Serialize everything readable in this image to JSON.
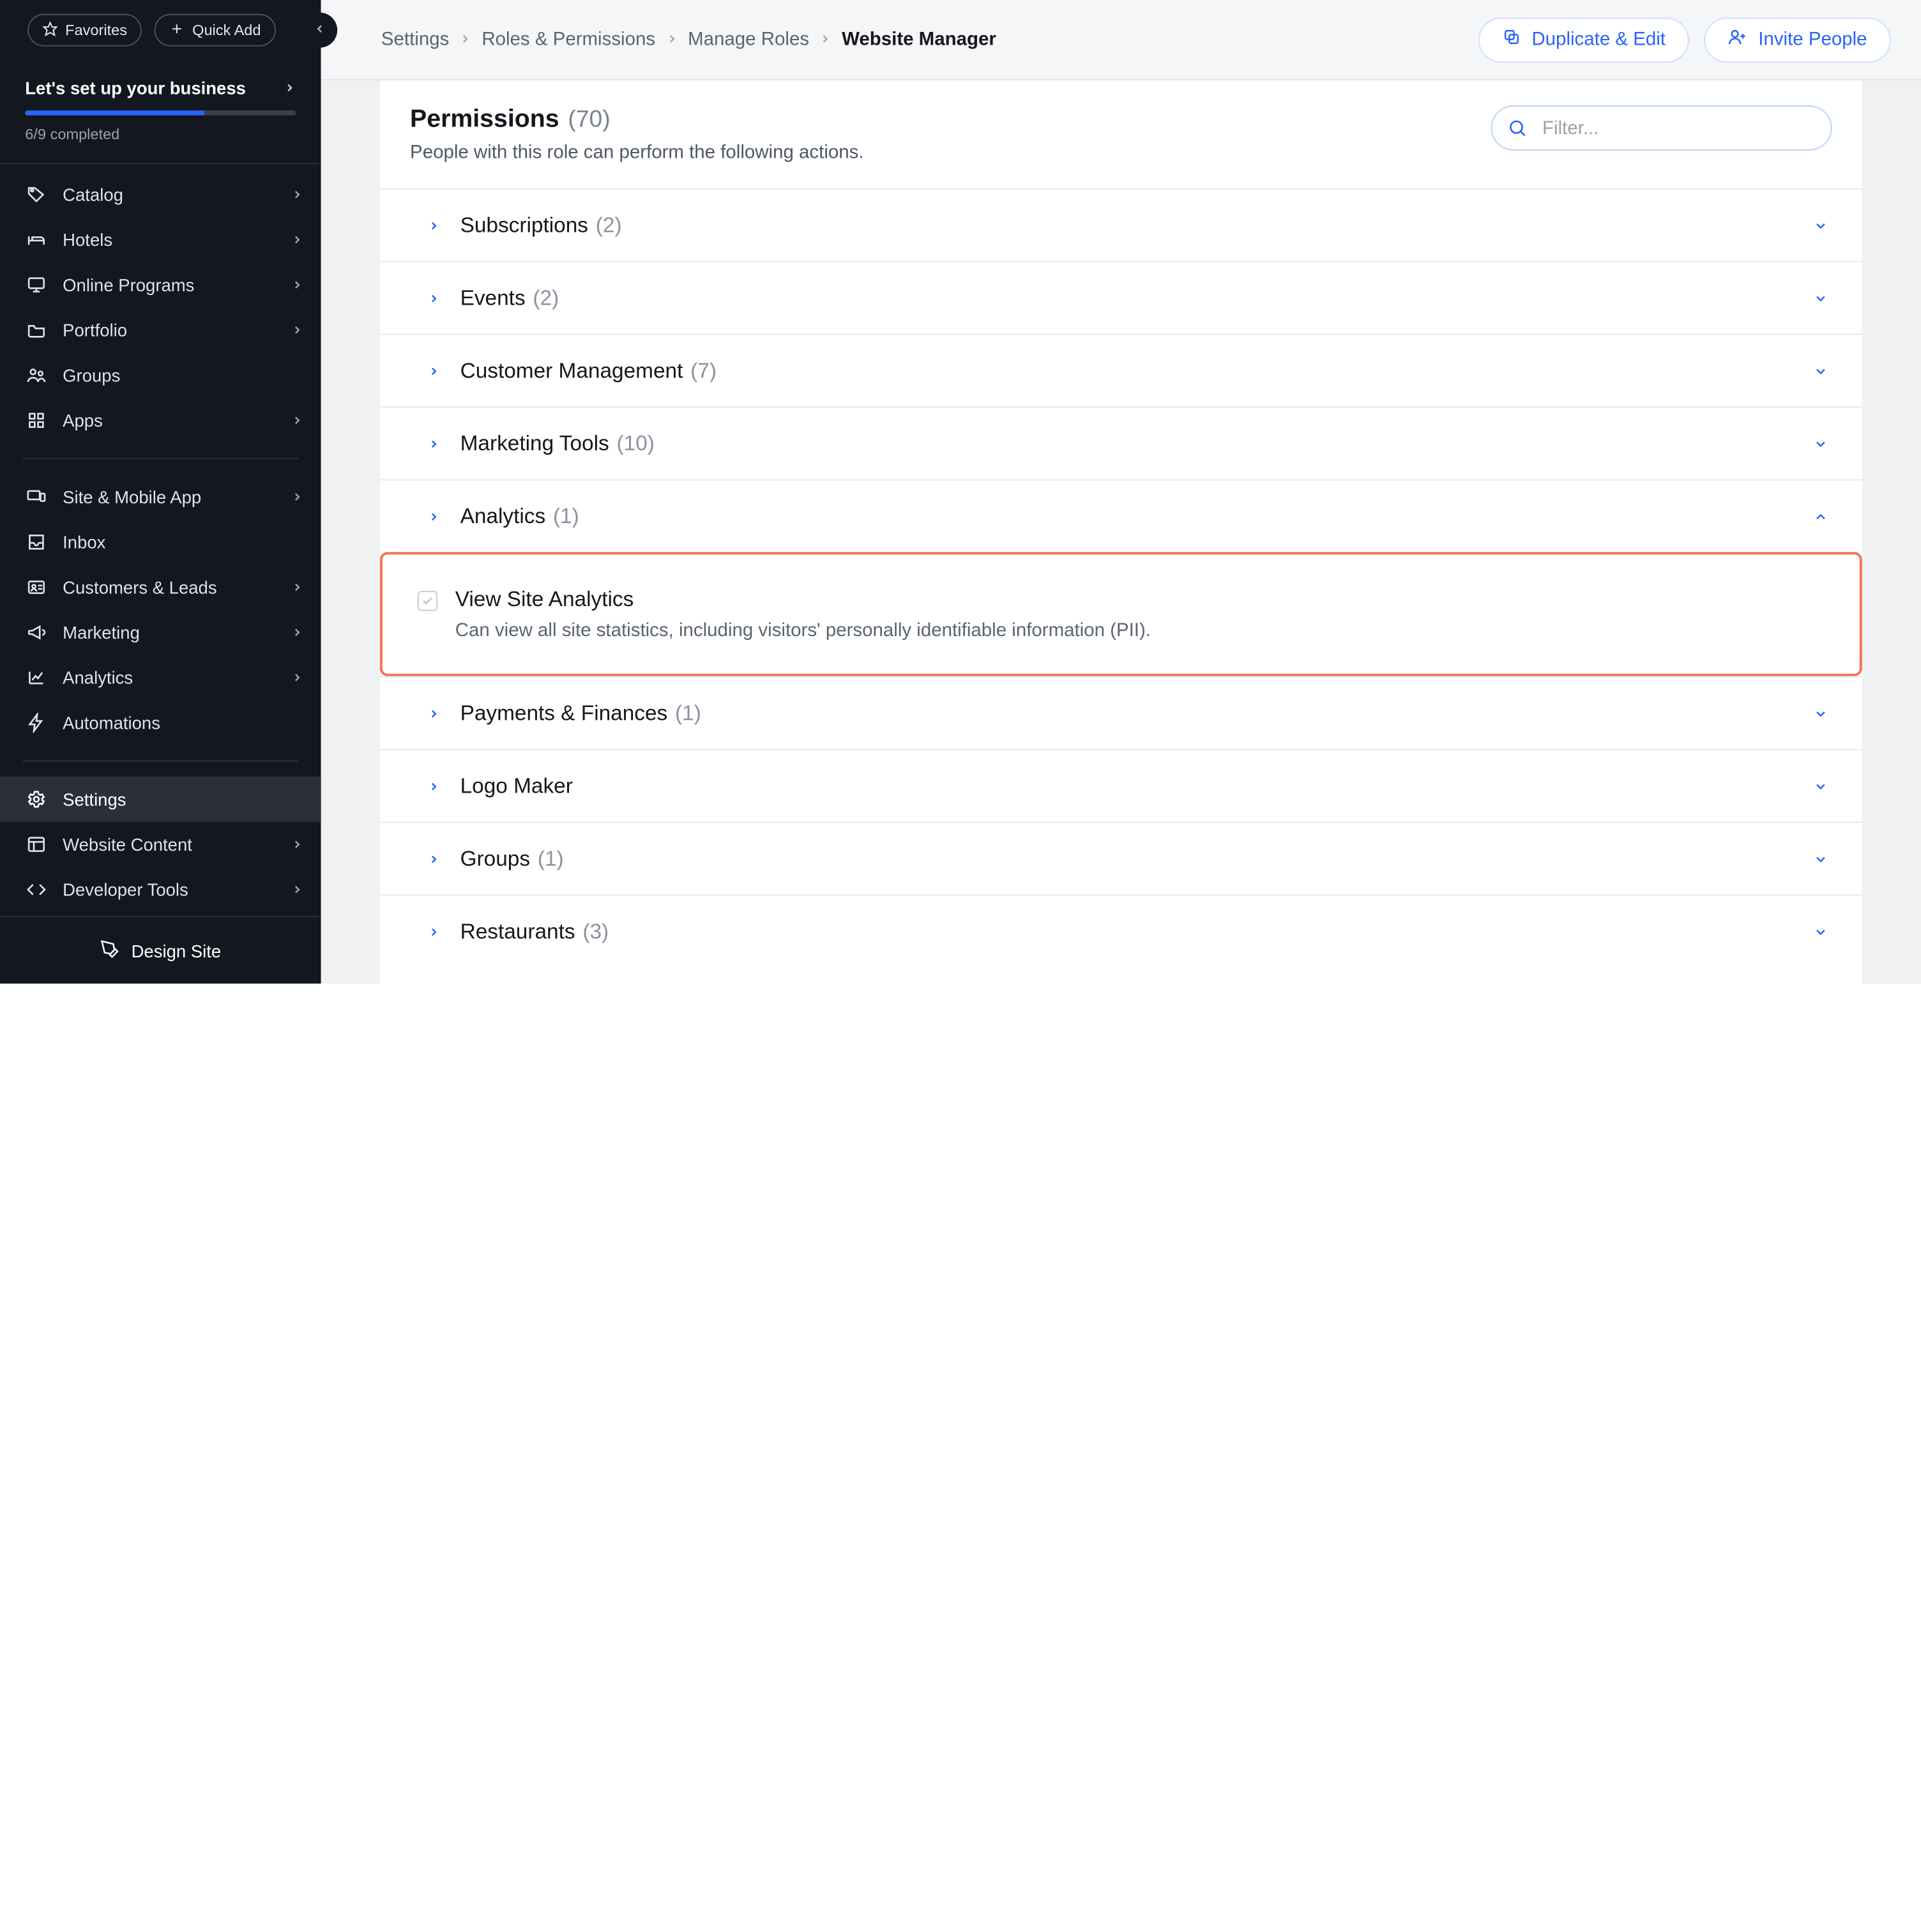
{
  "sidebar": {
    "top": {
      "favorites": "Favorites",
      "quick_add": "Quick Add"
    },
    "setup": {
      "title": "Let's set up your business",
      "completed_label": "6/9 completed",
      "progress_pct": 66
    },
    "nav": [
      {
        "id": "catalog",
        "label": "Catalog",
        "icon": "tag-icon",
        "chevron": true
      },
      {
        "id": "hotels",
        "label": "Hotels",
        "icon": "bed-icon",
        "chevron": true
      },
      {
        "id": "online-programs",
        "label": "Online Programs",
        "icon": "monitor-icon",
        "chevron": true
      },
      {
        "id": "portfolio",
        "label": "Portfolio",
        "icon": "folder-icon",
        "chevron": true
      },
      {
        "id": "groups",
        "label": "Groups",
        "icon": "people-icon",
        "chevron": false
      },
      {
        "id": "apps",
        "label": "Apps",
        "icon": "grid-icon",
        "chevron": true
      }
    ],
    "nav2": [
      {
        "id": "site-mobile",
        "label": "Site & Mobile App",
        "icon": "devices-icon",
        "chevron": true
      },
      {
        "id": "inbox",
        "label": "Inbox",
        "icon": "inbox-icon",
        "chevron": false
      },
      {
        "id": "customers-leads",
        "label": "Customers & Leads",
        "icon": "card-icon",
        "chevron": true
      },
      {
        "id": "marketing",
        "label": "Marketing",
        "icon": "megaphone-icon",
        "chevron": true
      },
      {
        "id": "analytics",
        "label": "Analytics",
        "icon": "chart-icon",
        "chevron": true
      },
      {
        "id": "automations",
        "label": "Automations",
        "icon": "bolt-icon",
        "chevron": false
      }
    ],
    "nav3": [
      {
        "id": "settings",
        "label": "Settings",
        "icon": "gear-icon",
        "chevron": false,
        "active": true
      },
      {
        "id": "website-content",
        "label": "Website Content",
        "icon": "layout-icon",
        "chevron": true
      },
      {
        "id": "developer-tools",
        "label": "Developer Tools",
        "icon": "code-icon",
        "chevron": true
      }
    ],
    "footer": {
      "label": "Design Site",
      "icon": "pen-icon"
    }
  },
  "header": {
    "crumbs": [
      "Settings",
      "Roles & Permissions",
      "Manage Roles",
      "Website Manager"
    ],
    "actions": {
      "duplicate": "Duplicate & Edit",
      "invite": "Invite People"
    }
  },
  "panel": {
    "title": "Permissions",
    "count_label": "(70)",
    "subtitle": "People with this role can perform the following actions.",
    "filter_placeholder": "Filter..."
  },
  "permissions": [
    {
      "id": "subscriptions",
      "name": "Subscriptions",
      "count": "(2)",
      "open": false
    },
    {
      "id": "events",
      "name": "Events",
      "count": "(2)",
      "open": false
    },
    {
      "id": "customer-management",
      "name": "Customer Management",
      "count": "(7)",
      "open": false
    },
    {
      "id": "marketing-tools",
      "name": "Marketing Tools",
      "count": "(10)",
      "open": false
    },
    {
      "id": "analytics",
      "name": "Analytics",
      "count": "(1)",
      "open": true,
      "items": [
        {
          "id": "view-site-analytics",
          "title": "View Site Analytics",
          "desc": "Can view all site statistics, including visitors' personally identifiable information (PII)."
        }
      ]
    },
    {
      "id": "payments-finances",
      "name": "Payments & Finances",
      "count": "(1)",
      "open": false
    },
    {
      "id": "logo-maker",
      "name": "Logo Maker",
      "count": "",
      "open": false
    },
    {
      "id": "groups",
      "name": "Groups",
      "count": "(1)",
      "open": false
    },
    {
      "id": "restaurants",
      "name": "Restaurants",
      "count": "(3)",
      "open": false
    }
  ]
}
